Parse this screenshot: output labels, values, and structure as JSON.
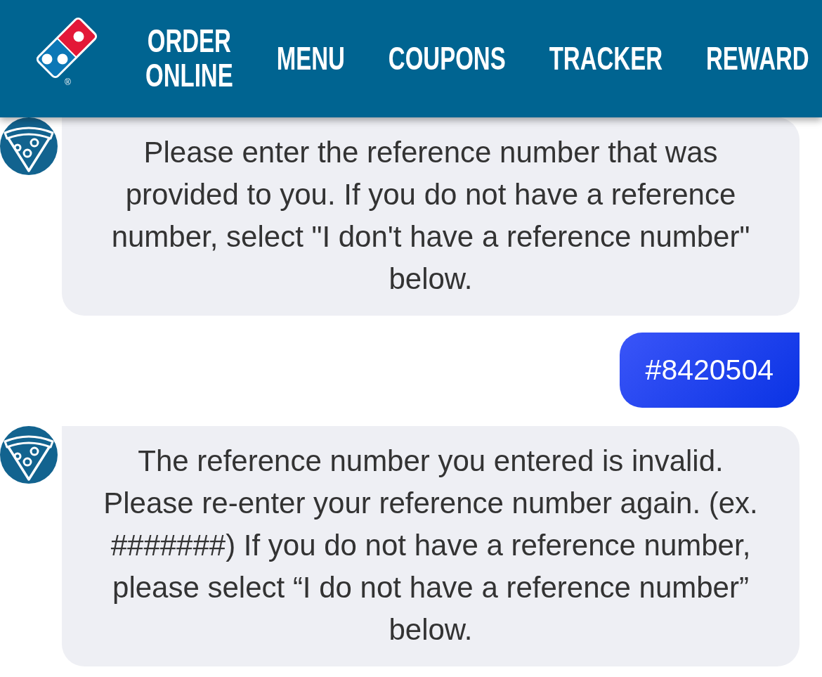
{
  "header": {
    "logo": {
      "registered_mark": "®"
    },
    "nav": [
      {
        "label": "ORDER ONLINE"
      },
      {
        "label": "MENU"
      },
      {
        "label": "COUPONS"
      },
      {
        "label": "TRACKER"
      },
      {
        "label": "REWARD"
      }
    ]
  },
  "messages": [
    {
      "kind": "bot",
      "text": "Please enter the reference number that was provided to you. If you do not have a reference number, select \"I don't have a reference number\" below."
    },
    {
      "kind": "user",
      "text": "#8420504"
    },
    {
      "kind": "bot",
      "text": "The reference number you entered is invalid. Please re-enter your reference number again. (ex. #######) If you do not have a reference number, please select “I do not have a reference number” below."
    }
  ]
}
